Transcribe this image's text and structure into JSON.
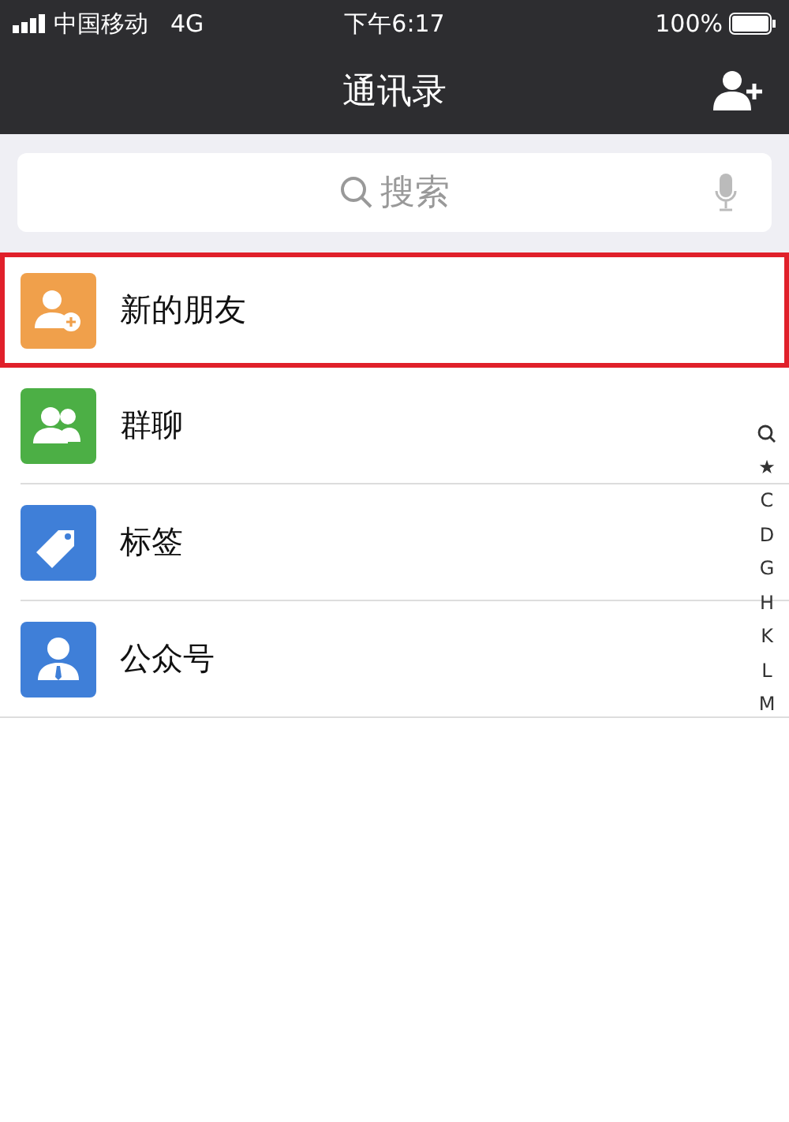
{
  "status_bar": {
    "carrier": "中国移动",
    "network": "4G",
    "time": "下午6:17",
    "battery_text": "100%"
  },
  "header": {
    "title": "通讯录"
  },
  "search": {
    "placeholder": "搜索"
  },
  "items": [
    {
      "label": "新的朋友",
      "kind": "new-friend",
      "color": "#f0a04b",
      "highlighted": true
    },
    {
      "label": "群聊",
      "kind": "group",
      "color": "#4caf45",
      "highlighted": false
    },
    {
      "label": "标签",
      "kind": "tag",
      "color": "#3f7fd8",
      "highlighted": false
    },
    {
      "label": "公众号",
      "kind": "official",
      "color": "#3f7fd8",
      "highlighted": false
    }
  ],
  "index": [
    {
      "kind": "search"
    },
    {
      "kind": "letter",
      "label": "★"
    },
    {
      "kind": "letter",
      "label": "C"
    },
    {
      "kind": "letter",
      "label": "D"
    },
    {
      "kind": "letter",
      "label": "G"
    },
    {
      "kind": "letter",
      "label": "H"
    },
    {
      "kind": "letter",
      "label": "K"
    },
    {
      "kind": "letter",
      "label": "L"
    },
    {
      "kind": "letter",
      "label": "M"
    }
  ]
}
